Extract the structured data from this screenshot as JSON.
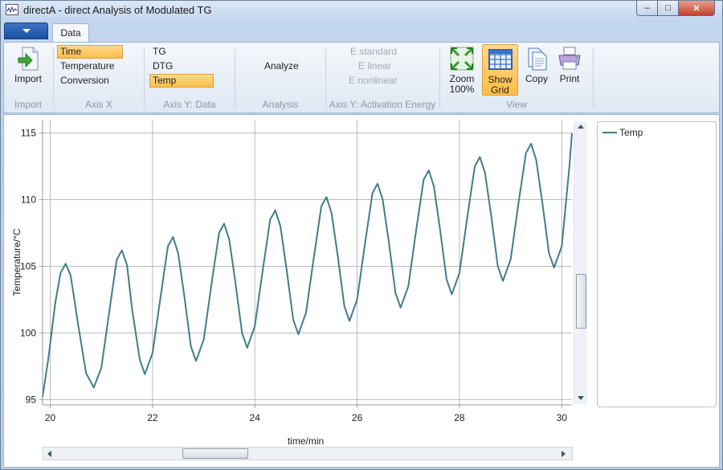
{
  "window": {
    "title": "directA - direct Analysis of Modulated TG",
    "controls": {
      "minimize": "‒",
      "maximize": "□",
      "close": "✕"
    }
  },
  "ribbon": {
    "tabs": [
      {
        "label": "Data",
        "active": true
      }
    ],
    "groups": {
      "import": {
        "label": "Import",
        "button": "Import"
      },
      "axis_x": {
        "label": "Axis X",
        "options": [
          "Time",
          "Temperature",
          "Conversion"
        ],
        "selected": "Time"
      },
      "axis_y_data": {
        "label": "Axis Y: Data",
        "options": [
          "TG",
          "DTG",
          "Temp"
        ],
        "selected": "Temp"
      },
      "analysis": {
        "label": "Analysis",
        "button": "Analyze"
      },
      "activation": {
        "label": "Axis Y: Activation Energy",
        "options": [
          "E standard",
          "E linear",
          "E nonlinear"
        ]
      },
      "view": {
        "label": "View",
        "zoom_line1": "Zoom",
        "zoom_line2": "100%",
        "grid_line1": "Show",
        "grid_line2": "Grid",
        "grid_active": true,
        "copy": "Copy",
        "print": "Print"
      }
    }
  },
  "legend": {
    "entries": [
      {
        "name": "Temp",
        "color": "#417d88"
      }
    ]
  },
  "chart_data": {
    "type": "line",
    "xlabel": "time/min",
    "ylabel": "Temperature/°C",
    "xlim": [
      19.85,
      30.2
    ],
    "ylim": [
      94.6,
      116
    ],
    "xticks": [
      20,
      22,
      24,
      26,
      28,
      30
    ],
    "yticks": [
      95,
      100,
      105,
      110,
      115
    ],
    "grid": true,
    "legend_position": "right panel",
    "series": [
      {
        "name": "Temp",
        "color": "#417d88",
        "points": [
          [
            19.85,
            95.2
          ],
          [
            19.96,
            98.0
          ],
          [
            20.1,
            102.3
          ],
          [
            20.2,
            104.5
          ],
          [
            20.3,
            105.2
          ],
          [
            20.4,
            104.3
          ],
          [
            20.55,
            100.5
          ],
          [
            20.7,
            97.0
          ],
          [
            20.85,
            95.9
          ],
          [
            21.0,
            97.4
          ],
          [
            21.15,
            101.5
          ],
          [
            21.3,
            105.5
          ],
          [
            21.4,
            106.2
          ],
          [
            21.5,
            105.1
          ],
          [
            21.6,
            101.8
          ],
          [
            21.75,
            98.0
          ],
          [
            21.85,
            96.9
          ],
          [
            22.0,
            98.5
          ],
          [
            22.15,
            102.5
          ],
          [
            22.3,
            106.5
          ],
          [
            22.4,
            107.2
          ],
          [
            22.5,
            106.0
          ],
          [
            22.62,
            102.8
          ],
          [
            22.75,
            99.0
          ],
          [
            22.85,
            97.9
          ],
          [
            23.0,
            99.5
          ],
          [
            23.15,
            103.6
          ],
          [
            23.3,
            107.5
          ],
          [
            23.4,
            108.2
          ],
          [
            23.5,
            107.0
          ],
          [
            23.62,
            103.8
          ],
          [
            23.75,
            100.0
          ],
          [
            23.85,
            98.9
          ],
          [
            24.0,
            100.5
          ],
          [
            24.15,
            104.6
          ],
          [
            24.3,
            108.5
          ],
          [
            24.4,
            109.2
          ],
          [
            24.5,
            108.0
          ],
          [
            24.62,
            104.8
          ],
          [
            24.75,
            101.0
          ],
          [
            24.85,
            99.9
          ],
          [
            25.0,
            101.5
          ],
          [
            25.15,
            105.6
          ],
          [
            25.3,
            109.5
          ],
          [
            25.4,
            110.2
          ],
          [
            25.5,
            109.0
          ],
          [
            25.62,
            105.8
          ],
          [
            25.75,
            102.0
          ],
          [
            25.85,
            100.9
          ],
          [
            26.0,
            102.5
          ],
          [
            26.15,
            106.6
          ],
          [
            26.3,
            110.5
          ],
          [
            26.4,
            111.2
          ],
          [
            26.5,
            110.0
          ],
          [
            26.62,
            106.8
          ],
          [
            26.75,
            103.0
          ],
          [
            26.85,
            101.9
          ],
          [
            27.0,
            103.5
          ],
          [
            27.15,
            107.6
          ],
          [
            27.3,
            111.5
          ],
          [
            27.4,
            112.2
          ],
          [
            27.5,
            111.0
          ],
          [
            27.62,
            107.8
          ],
          [
            27.75,
            104.0
          ],
          [
            27.85,
            102.9
          ],
          [
            28.0,
            104.5
          ],
          [
            28.15,
            108.6
          ],
          [
            28.3,
            112.5
          ],
          [
            28.4,
            113.2
          ],
          [
            28.5,
            112.0
          ],
          [
            28.62,
            108.8
          ],
          [
            28.75,
            105.0
          ],
          [
            28.85,
            103.9
          ],
          [
            29.0,
            105.5
          ],
          [
            29.15,
            109.6
          ],
          [
            29.3,
            113.5
          ],
          [
            29.4,
            114.2
          ],
          [
            29.5,
            113.0
          ],
          [
            29.62,
            109.8
          ],
          [
            29.75,
            106.0
          ],
          [
            29.85,
            104.9
          ],
          [
            30.0,
            106.5
          ],
          [
            30.15,
            112.5
          ],
          [
            30.2,
            115.0
          ]
        ]
      }
    ]
  }
}
